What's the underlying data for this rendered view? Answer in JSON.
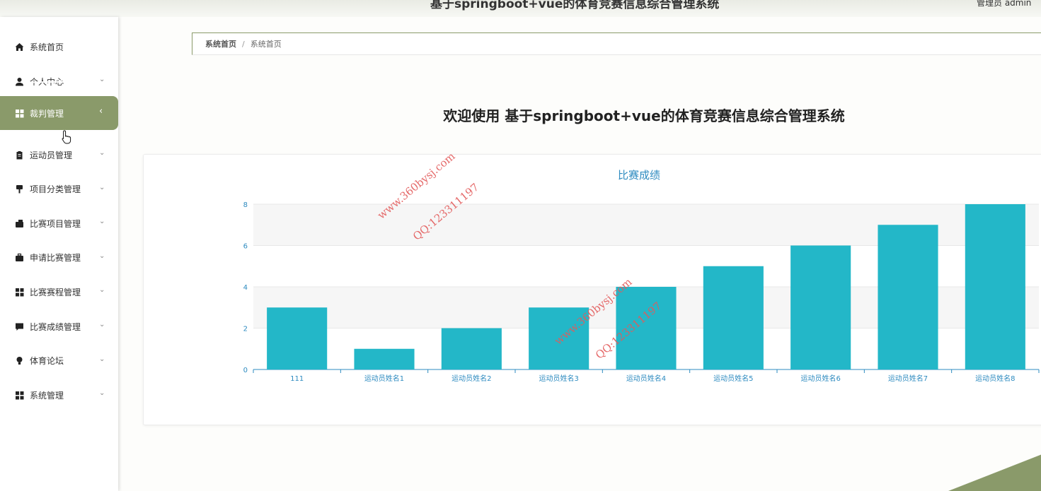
{
  "header": {
    "title": "基于springboot+vue的体育竞赛信息综合管理系统",
    "user": "管理员 admin"
  },
  "sidebar": {
    "items": [
      {
        "label": "系统首页",
        "icon": "home-icon",
        "has_children": false,
        "active": false
      },
      {
        "label": "个人中心",
        "icon": "user-icon",
        "has_children": true,
        "active": false
      },
      {
        "label": "裁判管理",
        "icon": "grid-icon",
        "has_children": true,
        "active": true
      },
      {
        "label": "运动员管理",
        "icon": "clipboard-icon",
        "has_children": true,
        "active": false
      },
      {
        "label": "项目分类管理",
        "icon": "brush-icon",
        "has_children": true,
        "active": false
      },
      {
        "label": "比赛项目管理",
        "icon": "wallet-icon",
        "has_children": true,
        "active": false
      },
      {
        "label": "申请比赛管理",
        "icon": "briefcase-icon",
        "has_children": true,
        "active": false
      },
      {
        "label": "比赛赛程管理",
        "icon": "grid-icon",
        "has_children": true,
        "active": false
      },
      {
        "label": "比赛成绩管理",
        "icon": "message-icon",
        "has_children": true,
        "active": false
      },
      {
        "label": "体育论坛",
        "icon": "bulb-icon",
        "has_children": true,
        "active": false
      },
      {
        "label": "系统管理",
        "icon": "grid-icon",
        "has_children": true,
        "active": false
      }
    ]
  },
  "breadcrumb": [
    "系统首页",
    "系统首页"
  ],
  "breadcrumb_sep": "/",
  "welcome": "欢迎使用 基于springboot+vue的体育竞赛信息综合管理系统",
  "watermarks": [
    "www.360bysj.com",
    "QQ:123311197"
  ],
  "colors": {
    "accent": "#8a9a6a",
    "bar": "#23b7c8",
    "title": "#2e8bc0"
  },
  "chart_data": {
    "type": "bar",
    "title": "比赛成绩",
    "categories": [
      "111",
      "运动员姓名1",
      "运动员姓名2",
      "运动员姓名3",
      "运动员姓名4",
      "运动员姓名5",
      "运动员姓名6",
      "运动员姓名7",
      "运动员姓名8"
    ],
    "values": [
      3,
      1,
      2,
      3,
      4,
      5,
      6,
      7,
      8
    ],
    "ylim": [
      0,
      8
    ],
    "yticks": [
      0,
      2,
      4,
      6,
      8
    ],
    "grid": true,
    "xlabel": "",
    "ylabel": ""
  }
}
